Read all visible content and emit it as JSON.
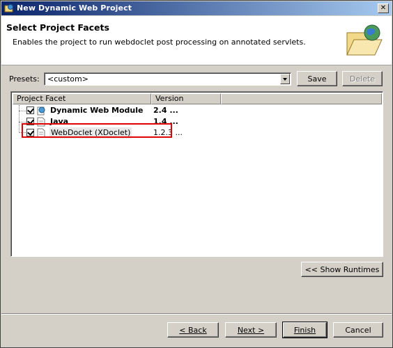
{
  "window": {
    "title": "New Dynamic Web Project",
    "close_label": "✕"
  },
  "banner": {
    "heading": "Select Project Facets",
    "description": "Enables the project to run webdoclet post processing on annotated servlets."
  },
  "presets": {
    "label": "Presets:",
    "value": "<custom>",
    "save_label": "Save",
    "delete_label": "Delete"
  },
  "table": {
    "columns": [
      "Project Facet",
      "Version"
    ],
    "rows": [
      {
        "name": "Dynamic Web Module",
        "version": "2.4 ...",
        "checked": true,
        "bold": true
      },
      {
        "name": "Java",
        "version": "1.4 ...",
        "checked": true,
        "bold": true
      },
      {
        "name": "WebDoclet (XDoclet)",
        "version": "1.2.3 ...",
        "checked": true,
        "bold": false
      }
    ]
  },
  "show_runtimes_label": "<< Show Runtimes",
  "footer": {
    "back_label": "< Back",
    "next_label": "Next >",
    "finish_label": "Finish",
    "cancel_label": "Cancel"
  },
  "colors": {
    "title_start": "#0a246a",
    "title_end": "#a6caf0",
    "highlight": "#e00000",
    "dialog_bg": "#d4d0c8"
  }
}
